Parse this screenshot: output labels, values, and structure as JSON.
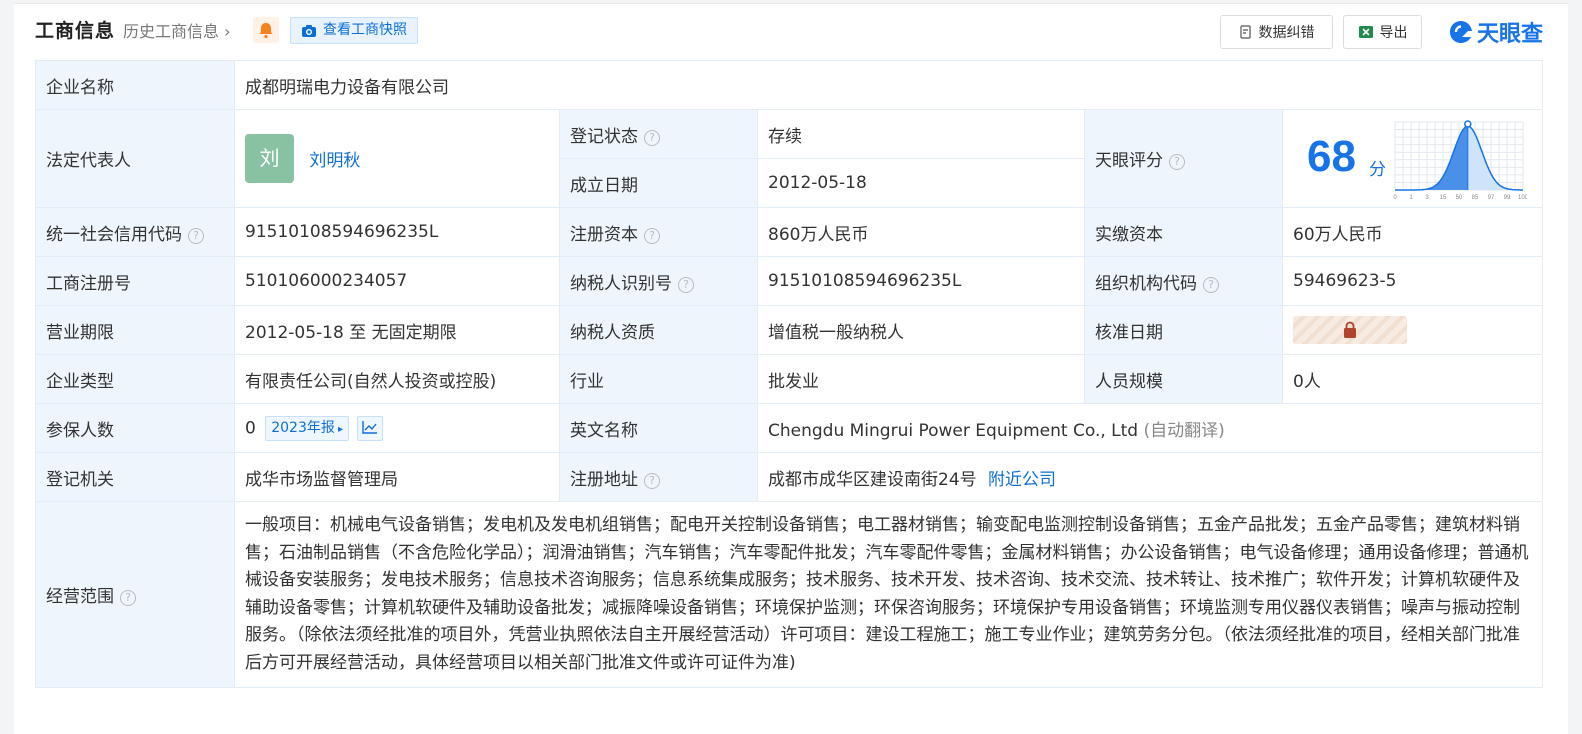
{
  "header": {
    "title": "工商信息",
    "history_link": "历史工商信息",
    "snapshot_button": "查看工商快照",
    "data_correction_button": "数据纠错",
    "export_button": "导出",
    "logo_text": "天眼查"
  },
  "fields": {
    "company_name_label": "企业名称",
    "company_name": "成都明瑞电力设备有限公司",
    "legal_rep_label": "法定代表人",
    "legal_rep_avatar": "刘",
    "legal_rep_name": "刘明秋",
    "reg_status_label": "登记状态",
    "reg_status": "存续",
    "founded_label": "成立日期",
    "founded": "2012-05-18",
    "score_label": "天眼评分",
    "score": "68",
    "score_unit": "分",
    "credit_code_label": "统一社会信用代码",
    "credit_code": "91510108594696235L",
    "reg_capital_label": "注册资本",
    "reg_capital": "860万人民币",
    "paid_capital_label": "实缴资本",
    "paid_capital": "60万人民币",
    "biz_reg_no_label": "工商注册号",
    "biz_reg_no": "510106000234057",
    "taxpayer_id_label": "纳税人识别号",
    "taxpayer_id": "91510108594696235L",
    "org_code_label": "组织机构代码",
    "org_code": "59469623-5",
    "term_label": "营业期限",
    "term": "2012-05-18 至 无固定期限",
    "taxpayer_qual_label": "纳税人资质",
    "taxpayer_qual": "增值税一般纳税人",
    "approved_date_label": "核准日期",
    "type_label": "企业类型",
    "type": "有限责任公司(自然人投资或控股)",
    "industry_label": "行业",
    "industry": "批发业",
    "staff_label": "人员规模",
    "staff": "0人",
    "insured_label": "参保人数",
    "insured": "0",
    "insured_report": "2023年报",
    "english_name_label": "英文名称",
    "english_name": "Chengdu Mingrui Power Equipment Co., Ltd",
    "english_name_note": "(自动翻译)",
    "authority_label": "登记机关",
    "authority": "成华市场监督管理局",
    "address_label": "注册地址",
    "address": "成都市成华区建设南街24号",
    "nearby_link": "附近公司",
    "scope_label": "经营范围",
    "scope": "一般项目：机械电气设备销售；发电机及发电机组销售；配电开关控制设备销售；电工器材销售；输变配电监测控制设备销售；五金产品批发；五金产品零售；建筑材料销售；石油制品销售（不含危险化学品）；润滑油销售；汽车销售；汽车零配件批发；汽车零配件零售；金属材料销售；办公设备销售；电气设备修理；通用设备修理；普通机械设备安装服务；发电技术服务；信息技术咨询服务；信息系统集成服务；技术服务、技术开发、技术咨询、技术交流、技术转让、技术推广；软件开发；计算机软硬件及辅助设备零售；计算机软硬件及辅助设备批发；减振降噪设备销售；环境保护监测；环保咨询服务；环境保护专用设备销售；环境监测专用仪器仪表销售；噪声与振动控制服务。（除依法须经批准的项目外，凭营业执照依法自主开展经营活动）许可项目：建设工程施工；施工专业作业；建筑劳务分包。（依法须经批准的项目，经相关部门批准后方可开展经营活动，具体经营项目以相关部门批准文件或许可证件为准)"
  },
  "score_chart": {
    "ticks": [
      "0",
      "1",
      "3",
      "15",
      "50",
      "85",
      "97",
      "99",
      "100"
    ],
    "marker_value": 68
  },
  "colors": {
    "accent": "#1774e8",
    "label_bg": "#eef5fd",
    "status_green": "#1f9a4c",
    "avatar": "#89c2a3"
  }
}
